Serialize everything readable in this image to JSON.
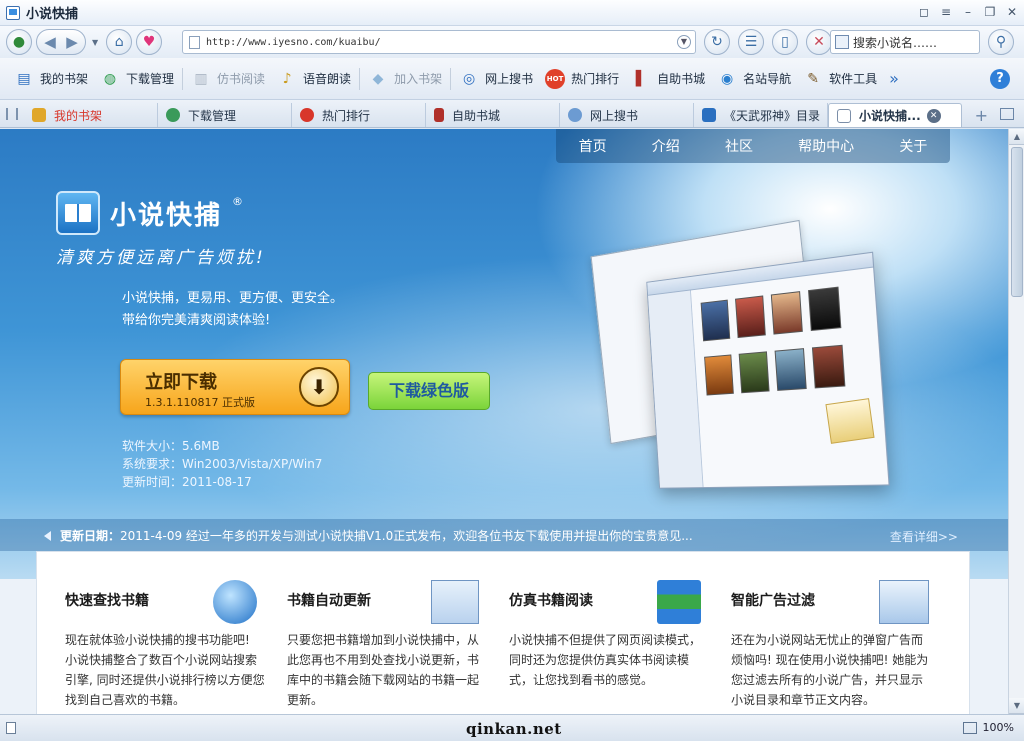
{
  "window": {
    "title": "小说快捕"
  },
  "navbar": {
    "url": "http://www.iyesno.com/kuaibu/",
    "search_placeholder": "搜索小说名……"
  },
  "toolbar": {
    "items": [
      {
        "label": "我的书架",
        "icon": "bookshelf-icon",
        "enabled": true
      },
      {
        "label": "下载管理",
        "icon": "globe-download-icon",
        "enabled": true
      },
      {
        "label": "仿书阅读",
        "icon": "book-read-icon",
        "enabled": false
      },
      {
        "label": "语音朗读",
        "icon": "microphone-icon",
        "enabled": true
      },
      {
        "label": "加入书架",
        "icon": "add-book-icon",
        "enabled": false
      },
      {
        "label": "网上搜书",
        "icon": "search-web-icon",
        "enabled": true
      },
      {
        "label": "热门排行",
        "icon": "hot-badge-icon",
        "enabled": true
      },
      {
        "label": "自助书城",
        "icon": "books-icon",
        "enabled": true
      },
      {
        "label": "名站导航",
        "icon": "globe-icon",
        "enabled": true
      },
      {
        "label": "软件工具",
        "icon": "tools-icon",
        "enabled": true
      }
    ],
    "more": "»"
  },
  "tabs": [
    {
      "label": "我的书架",
      "color": "#d8362a"
    },
    {
      "label": "下载管理",
      "color": "#243549"
    },
    {
      "label": "热门排行",
      "color": "#243549"
    },
    {
      "label": "自助书城",
      "color": "#243549"
    },
    {
      "label": "网上搜书",
      "color": "#243549"
    },
    {
      "label": "《天武邪神》目录",
      "color": "#243549"
    },
    {
      "label": "小说快捕...",
      "color": "#111111"
    }
  ],
  "site": {
    "nav": [
      "首页",
      "介绍",
      "社区",
      "帮助中心",
      "关于"
    ],
    "brand": "小说快捕",
    "brand_mark": "®",
    "slogan": "清爽方便远离广告烦扰!",
    "intro_line1": "小说快捕，更易用、更方便、更安全。",
    "intro_line2": "带给你完美清爽阅读体验!",
    "download_title": "立即下载",
    "download_version": "1.3.1.110817 正式版",
    "green_download": "下载绿色版",
    "spec_size": "软件大小：5.6MB",
    "spec_sys": "系统要求：Win2003/Vista/XP/Win7",
    "spec_date": "更新时间：2011-08-17",
    "news_label": "更新日期：",
    "news_text": "2011-4-09 经过一年多的开发与测试小说快捕V1.0正式发布，欢迎各位书友下载使用并提出你的宝贵意见...",
    "news_more": "查看详细>>"
  },
  "features": [
    {
      "title": "快速查找书籍",
      "desc": "现在就体验小说快捕的搜书功能吧! 小说快捕整合了数百个小说网站搜索引擎, 同时还提供小说排行榜以方便您找到自己喜欢的书籍。",
      "icon": "magnifier-icon"
    },
    {
      "title": "书籍自动更新",
      "desc": "只要您把书籍增加到小说快捕中，从此您再也不用到处查找小说更新，书库中的书籍会随下载网站的书籍一起更新。",
      "icon": "calendar-update-icon"
    },
    {
      "title": "仿真书籍阅读",
      "desc": "小说快捕不但提供了网页阅读模式，同时还为您提供仿真实体书阅读模式，让您找到看书的感觉。",
      "icon": "stacked-books-icon"
    },
    {
      "title": "智能广告过滤",
      "desc": "还在为小说网站无忧止的弹窗广告而烦恼吗! 现在使用小说快捕吧! 她能为您过滤去所有的小说广告，并只显示小说目录和章节正文内容。",
      "icon": "ad-block-icon"
    }
  ],
  "status": {
    "watermark": "qinkan.net",
    "zoom": "100%"
  },
  "colors": {
    "accent_blue": "#2c7bc4",
    "download_orange": "#f7a51b",
    "download_green": "#7bd43a"
  }
}
